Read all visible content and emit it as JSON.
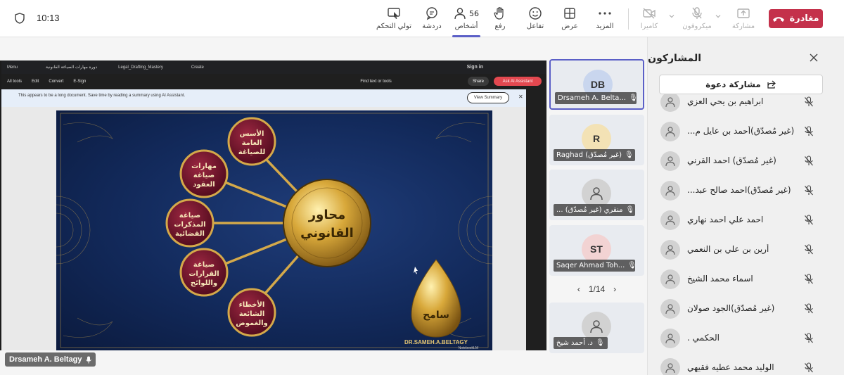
{
  "topbar": {
    "time": "10:13",
    "leave_label": "مغادرة",
    "share_label": "مشاركة",
    "mic_label": "ميكروفون",
    "camera_label": "كاميرا",
    "more_label": "المزيد",
    "view_label": "عرض",
    "react_label": "تفاعل",
    "raise_label": "رفع",
    "people_label": "أشخاص",
    "people_count": "56",
    "chat_label": "دردشة",
    "control_label": "تولي التحكم"
  },
  "stage": {
    "browser_tabs": [
      "Menu",
      "دورة مهارات الصياغة القانونية",
      "Legal_Drafting_Mastery",
      "Create"
    ],
    "pdf_tools": [
      "All tools",
      "Edit",
      "Convert",
      "E-Sign"
    ],
    "find_text": "Find text or tools",
    "share": "Share",
    "ask_ai": "Ask AI Assistant",
    "sign_in": "Sign in",
    "notice": "This appears to be a long document. Save time by reading a summary using AI Assistant.",
    "view_summary": "View Summary",
    "slide": {
      "center": "محاور القانوني",
      "nodes": [
        "الأسس العامة للصياغة",
        "مهارات صياغة العقود",
        "صياغة المذكرات القضائية",
        "صياغة القرارات واللوائح",
        "الأخطاء الشائعة والغموض"
      ],
      "brand": "DR.SAMEH.A.BELTAGY",
      "watermark": "NotebookLM"
    },
    "speaker": "Drsameh A. Beltagy"
  },
  "tiles": [
    {
      "initials": "DB",
      "name": "Drsameh A. Belta...",
      "color": "#c9d6ee"
    },
    {
      "initials": "R",
      "name": "Raghad (غير مُصدّق)",
      "color": "#f3e2b5"
    },
    {
      "initials": "",
      "name": "... منقري (غير مُصدّق)",
      "color": "#d2d2d2"
    },
    {
      "initials": "ST",
      "name": "Saqer Ahmad Toh...",
      "color": "#f2d3d3"
    },
    {
      "initials": "",
      "name": "د. أحمد شيخ",
      "color": "#d2d2d2"
    }
  ],
  "pager": "1/14",
  "panel": {
    "title": "المشاركون",
    "invite": "مشاركة دعوة",
    "participants": [
      "ابراهيم بن يحي العزي",
      "(غير مُصدّق)أحمد بن عايل م...",
      "(غير مُصدّق) احمد القرني",
      "(غير مُصدّق)احمد صالح عبد...",
      "احمد علي احمد نهاري",
      "أرين بن علي بن النعمي",
      "اسماء محمد الشيخ",
      "(غير مُصدّق)الجود صولان",
      "الحكمي .",
      "الوليد محمد عطيه فقيهي"
    ]
  }
}
